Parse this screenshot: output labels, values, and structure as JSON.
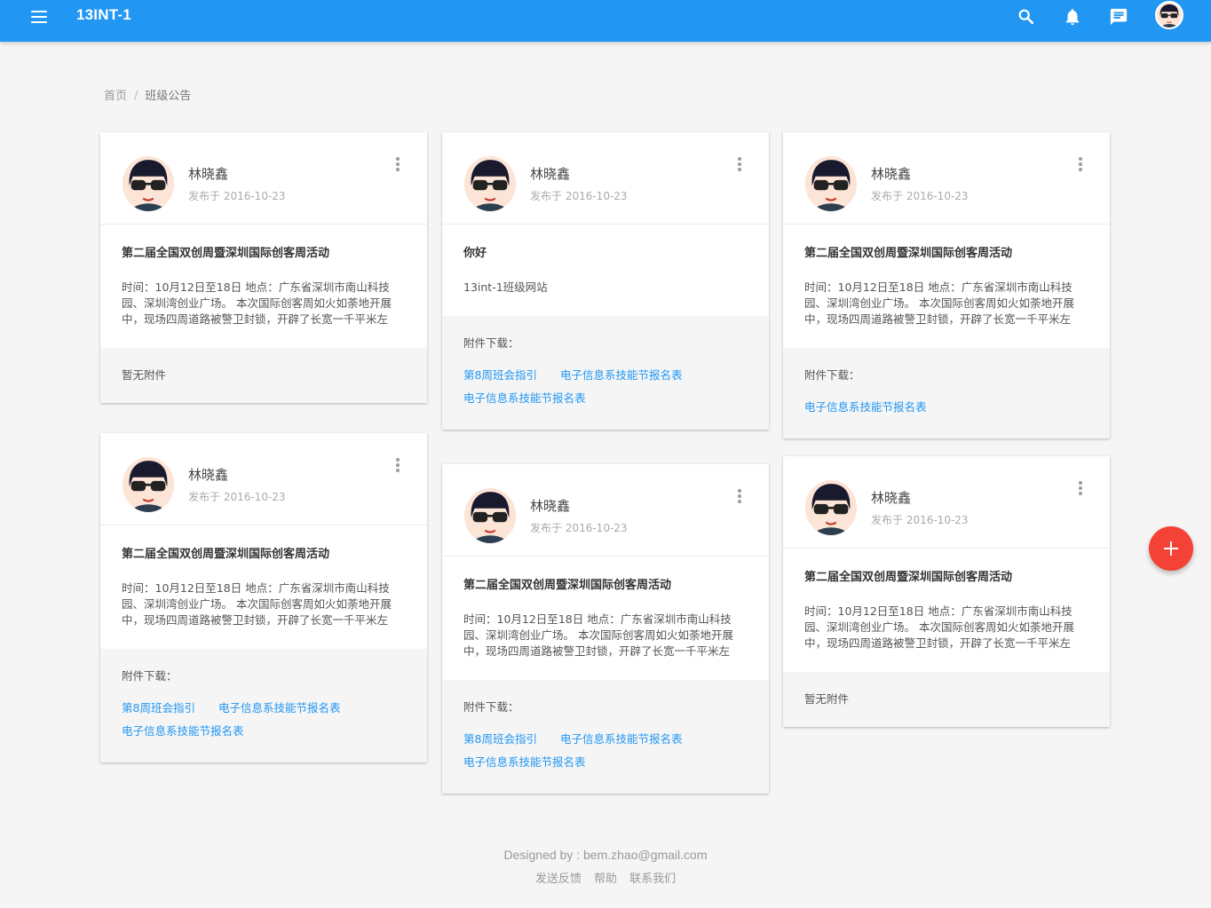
{
  "header": {
    "title": "13INT-1",
    "icons": [
      "menu-icon",
      "search-icon",
      "bell-icon",
      "message-icon",
      "user-avatar"
    ],
    "color": "#2196f3"
  },
  "breadcrumb": {
    "home": "首页",
    "separator": "/",
    "current": "班级公告"
  },
  "cards": [
    {
      "author": "林晓鑫",
      "date": "发布于 2016-10-23",
      "title": "第二届全国双创周暨深圳国际创客周活动",
      "content": "时间：10月12日至18日 地点：广东省深圳市南山科技园、深圳湾创业广场。 本次国际创客周如火如荼地开展中，现场四周道路被警卫封锁，开辟了长宽一千平米左",
      "attachments_none": "暂无附件",
      "attachments_label": "",
      "attachments": []
    },
    {
      "author": "林晓鑫",
      "date": "发布于 2016-10-23",
      "title": "你好",
      "content": "13int-1班级网站",
      "attachments_none": "",
      "attachments_label": "附件下载：",
      "attachments": [
        "第8周班会指引",
        "电子信息系技能节报名表",
        "电子信息系技能节报名表"
      ]
    },
    {
      "author": "林晓鑫",
      "date": "发布于 2016-10-23",
      "title": "第二届全国双创周暨深圳国际创客周活动",
      "content": "时间：10月12日至18日 地点：广东省深圳市南山科技园、深圳湾创业广场。 本次国际创客周如火如荼地开展中，现场四周道路被警卫封锁，开辟了长宽一千平米左",
      "attachments_none": "",
      "attachments_label": "附件下载：",
      "attachments": [
        "电子信息系技能节报名表"
      ]
    },
    {
      "author": "林晓鑫",
      "date": "发布于 2016-10-23",
      "title": "第二届全国双创周暨深圳国际创客周活动",
      "content": "时间：10月12日至18日 地点：广东省深圳市南山科技园、深圳湾创业广场。 本次国际创客周如火如荼地开展中，现场四周道路被警卫封锁，开辟了长宽一千平米左",
      "attachments_none": "",
      "attachments_label": "附件下载：",
      "attachments": [
        "第8周班会指引",
        "电子信息系技能节报名表",
        "电子信息系技能节报名表"
      ]
    },
    {
      "author": "林晓鑫",
      "date": "发布于 2016-10-23",
      "title": "第二届全国双创周暨深圳国际创客周活动",
      "content": "时间：10月12日至18日 地点：广东省深圳市南山科技园、深圳湾创业广场。 本次国际创客周如火如荼地开展中，现场四周道路被警卫封锁，开辟了长宽一千平米左",
      "attachments_none": "",
      "attachments_label": "附件下载：",
      "attachments": [
        "第8周班会指引",
        "电子信息系技能节报名表",
        "电子信息系技能节报名表"
      ]
    },
    {
      "author": "林晓鑫",
      "date": "发布于 2016-10-23",
      "title": "第二届全国双创周暨深圳国际创客周活动",
      "content": "时间：10月12日至18日 地点：广东省深圳市南山科技园、深圳湾创业广场。 本次国际创客周如火如荼地开展中，现场四周道路被警卫封锁，开辟了长宽一千平米左",
      "attachments_none": "暂无附件",
      "attachments_label": "",
      "attachments": []
    }
  ],
  "fab": {
    "icon": "plus-icon",
    "color": "#f44336"
  },
  "footer": {
    "designed_by": "Designed by : bem.zhao@gmail.com",
    "links": [
      "发送反馈",
      "帮助",
      "联系我们"
    ]
  },
  "colors": {
    "accent": "#2196f3",
    "fab": "#f44336",
    "background": "#f5f5f5"
  }
}
